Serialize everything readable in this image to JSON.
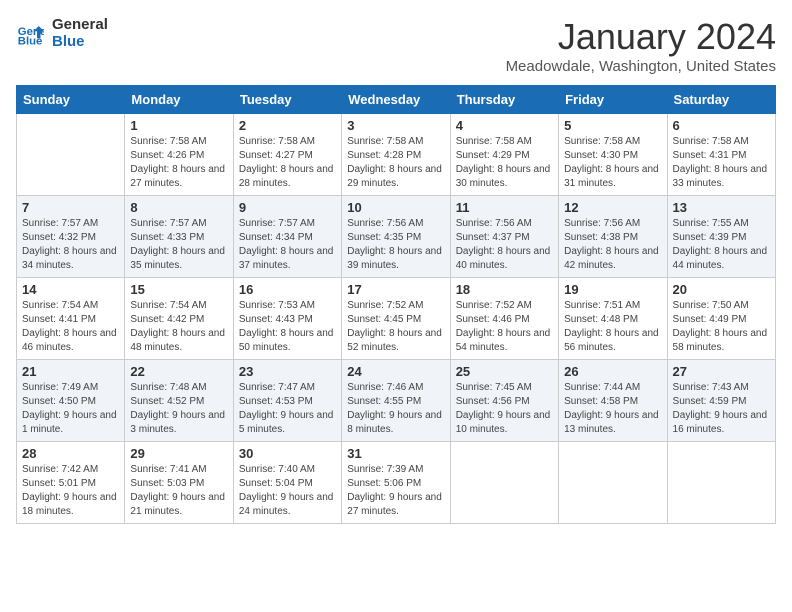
{
  "header": {
    "logo_line1": "General",
    "logo_line2": "Blue",
    "month": "January 2024",
    "location": "Meadowdale, Washington, United States"
  },
  "days_of_week": [
    "Sunday",
    "Monday",
    "Tuesday",
    "Wednesday",
    "Thursday",
    "Friday",
    "Saturday"
  ],
  "weeks": [
    [
      {
        "day": "",
        "sunrise": "",
        "sunset": "",
        "daylight": ""
      },
      {
        "day": "1",
        "sunrise": "Sunrise: 7:58 AM",
        "sunset": "Sunset: 4:26 PM",
        "daylight": "Daylight: 8 hours and 27 minutes."
      },
      {
        "day": "2",
        "sunrise": "Sunrise: 7:58 AM",
        "sunset": "Sunset: 4:27 PM",
        "daylight": "Daylight: 8 hours and 28 minutes."
      },
      {
        "day": "3",
        "sunrise": "Sunrise: 7:58 AM",
        "sunset": "Sunset: 4:28 PM",
        "daylight": "Daylight: 8 hours and 29 minutes."
      },
      {
        "day": "4",
        "sunrise": "Sunrise: 7:58 AM",
        "sunset": "Sunset: 4:29 PM",
        "daylight": "Daylight: 8 hours and 30 minutes."
      },
      {
        "day": "5",
        "sunrise": "Sunrise: 7:58 AM",
        "sunset": "Sunset: 4:30 PM",
        "daylight": "Daylight: 8 hours and 31 minutes."
      },
      {
        "day": "6",
        "sunrise": "Sunrise: 7:58 AM",
        "sunset": "Sunset: 4:31 PM",
        "daylight": "Daylight: 8 hours and 33 minutes."
      }
    ],
    [
      {
        "day": "7",
        "sunrise": "Sunrise: 7:57 AM",
        "sunset": "Sunset: 4:32 PM",
        "daylight": "Daylight: 8 hours and 34 minutes."
      },
      {
        "day": "8",
        "sunrise": "Sunrise: 7:57 AM",
        "sunset": "Sunset: 4:33 PM",
        "daylight": "Daylight: 8 hours and 35 minutes."
      },
      {
        "day": "9",
        "sunrise": "Sunrise: 7:57 AM",
        "sunset": "Sunset: 4:34 PM",
        "daylight": "Daylight: 8 hours and 37 minutes."
      },
      {
        "day": "10",
        "sunrise": "Sunrise: 7:56 AM",
        "sunset": "Sunset: 4:35 PM",
        "daylight": "Daylight: 8 hours and 39 minutes."
      },
      {
        "day": "11",
        "sunrise": "Sunrise: 7:56 AM",
        "sunset": "Sunset: 4:37 PM",
        "daylight": "Daylight: 8 hours and 40 minutes."
      },
      {
        "day": "12",
        "sunrise": "Sunrise: 7:56 AM",
        "sunset": "Sunset: 4:38 PM",
        "daylight": "Daylight: 8 hours and 42 minutes."
      },
      {
        "day": "13",
        "sunrise": "Sunrise: 7:55 AM",
        "sunset": "Sunset: 4:39 PM",
        "daylight": "Daylight: 8 hours and 44 minutes."
      }
    ],
    [
      {
        "day": "14",
        "sunrise": "Sunrise: 7:54 AM",
        "sunset": "Sunset: 4:41 PM",
        "daylight": "Daylight: 8 hours and 46 minutes."
      },
      {
        "day": "15",
        "sunrise": "Sunrise: 7:54 AM",
        "sunset": "Sunset: 4:42 PM",
        "daylight": "Daylight: 8 hours and 48 minutes."
      },
      {
        "day": "16",
        "sunrise": "Sunrise: 7:53 AM",
        "sunset": "Sunset: 4:43 PM",
        "daylight": "Daylight: 8 hours and 50 minutes."
      },
      {
        "day": "17",
        "sunrise": "Sunrise: 7:52 AM",
        "sunset": "Sunset: 4:45 PM",
        "daylight": "Daylight: 8 hours and 52 minutes."
      },
      {
        "day": "18",
        "sunrise": "Sunrise: 7:52 AM",
        "sunset": "Sunset: 4:46 PM",
        "daylight": "Daylight: 8 hours and 54 minutes."
      },
      {
        "day": "19",
        "sunrise": "Sunrise: 7:51 AM",
        "sunset": "Sunset: 4:48 PM",
        "daylight": "Daylight: 8 hours and 56 minutes."
      },
      {
        "day": "20",
        "sunrise": "Sunrise: 7:50 AM",
        "sunset": "Sunset: 4:49 PM",
        "daylight": "Daylight: 8 hours and 58 minutes."
      }
    ],
    [
      {
        "day": "21",
        "sunrise": "Sunrise: 7:49 AM",
        "sunset": "Sunset: 4:50 PM",
        "daylight": "Daylight: 9 hours and 1 minute."
      },
      {
        "day": "22",
        "sunrise": "Sunrise: 7:48 AM",
        "sunset": "Sunset: 4:52 PM",
        "daylight": "Daylight: 9 hours and 3 minutes."
      },
      {
        "day": "23",
        "sunrise": "Sunrise: 7:47 AM",
        "sunset": "Sunset: 4:53 PM",
        "daylight": "Daylight: 9 hours and 5 minutes."
      },
      {
        "day": "24",
        "sunrise": "Sunrise: 7:46 AM",
        "sunset": "Sunset: 4:55 PM",
        "daylight": "Daylight: 9 hours and 8 minutes."
      },
      {
        "day": "25",
        "sunrise": "Sunrise: 7:45 AM",
        "sunset": "Sunset: 4:56 PM",
        "daylight": "Daylight: 9 hours and 10 minutes."
      },
      {
        "day": "26",
        "sunrise": "Sunrise: 7:44 AM",
        "sunset": "Sunset: 4:58 PM",
        "daylight": "Daylight: 9 hours and 13 minutes."
      },
      {
        "day": "27",
        "sunrise": "Sunrise: 7:43 AM",
        "sunset": "Sunset: 4:59 PM",
        "daylight": "Daylight: 9 hours and 16 minutes."
      }
    ],
    [
      {
        "day": "28",
        "sunrise": "Sunrise: 7:42 AM",
        "sunset": "Sunset: 5:01 PM",
        "daylight": "Daylight: 9 hours and 18 minutes."
      },
      {
        "day": "29",
        "sunrise": "Sunrise: 7:41 AM",
        "sunset": "Sunset: 5:03 PM",
        "daylight": "Daylight: 9 hours and 21 minutes."
      },
      {
        "day": "30",
        "sunrise": "Sunrise: 7:40 AM",
        "sunset": "Sunset: 5:04 PM",
        "daylight": "Daylight: 9 hours and 24 minutes."
      },
      {
        "day": "31",
        "sunrise": "Sunrise: 7:39 AM",
        "sunset": "Sunset: 5:06 PM",
        "daylight": "Daylight: 9 hours and 27 minutes."
      },
      {
        "day": "",
        "sunrise": "",
        "sunset": "",
        "daylight": ""
      },
      {
        "day": "",
        "sunrise": "",
        "sunset": "",
        "daylight": ""
      },
      {
        "day": "",
        "sunrise": "",
        "sunset": "",
        "daylight": ""
      }
    ]
  ]
}
